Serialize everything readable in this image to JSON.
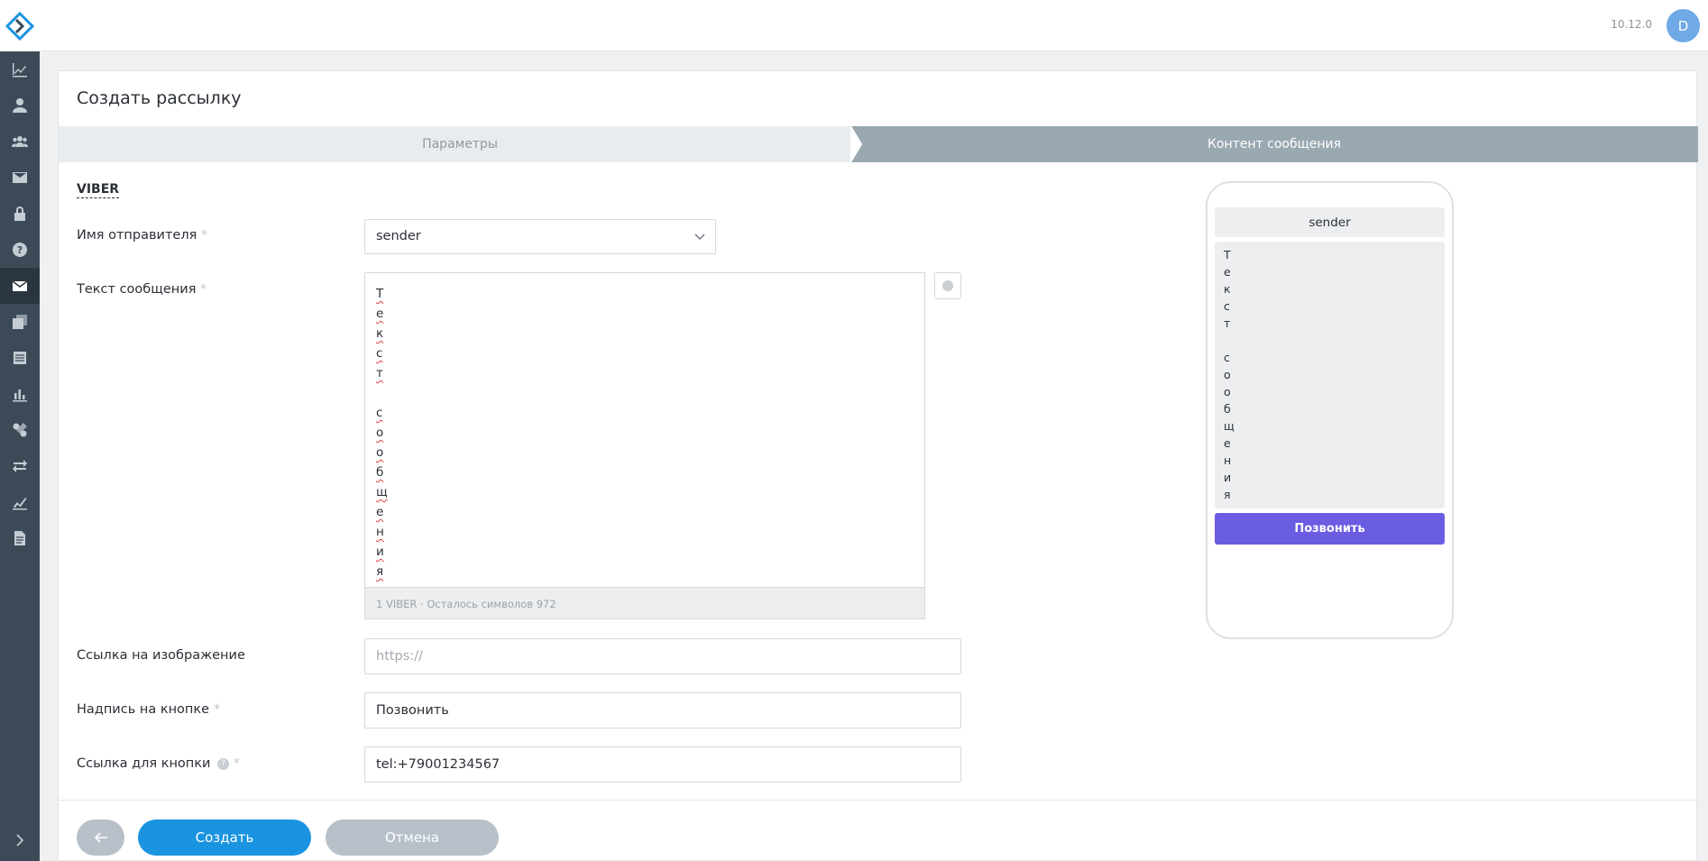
{
  "topbar": {
    "version": "10.12.0",
    "avatar_initial": "D"
  },
  "sidebar": {
    "items": [
      {
        "icon": "dashboard-chart-icon"
      },
      {
        "icon": "user-icon"
      },
      {
        "icon": "users-group-icon"
      },
      {
        "icon": "mail-icon"
      },
      {
        "icon": "lock-icon"
      },
      {
        "icon": "help-icon"
      },
      {
        "icon": "mailing-icon",
        "active": true
      },
      {
        "icon": "templates-icon"
      },
      {
        "icon": "database-icon"
      },
      {
        "icon": "bar-chart-icon"
      },
      {
        "icon": "integrations-icon"
      },
      {
        "icon": "transfer-arrows-icon"
      },
      {
        "icon": "reports-icon"
      },
      {
        "icon": "document-icon"
      }
    ]
  },
  "page": {
    "title": "Создать рассылку"
  },
  "steps": {
    "step1": "Параметры",
    "step2": "Контент сообщения"
  },
  "form": {
    "channel_label": "VIBER",
    "sender_label": "Имя отправителя",
    "sender_value": "sender",
    "message_label": "Текст сообщения",
    "message_value": "Т\nе\nк\nс\nт\n\nс\nо\nо\nб\nщ\nе\nн\nи\nя",
    "message_footer": "1 VIBER · Осталось символов 972",
    "image_link_label": "Ссылка на изображение",
    "image_link_placeholder": "https://",
    "button_text_label": "Надпись на кнопке",
    "button_text_value": "Позвонить",
    "button_link_label": "Ссылка для кнопки",
    "button_link_value": "tel:+79001234567",
    "required_mark": "*"
  },
  "preview": {
    "sender": "sender",
    "message": "Т\nе\nк\nс\nт\n\nс\nо\nо\nб\nщ\nе\nн\nи\nя",
    "button": "Позвонить"
  },
  "footer": {
    "create": "Создать",
    "cancel": "Отмена"
  },
  "colors": {
    "sidebar": "#3c4a57",
    "accent": "#1a94e0",
    "viber_button": "#6b5de2",
    "avatar": "#6fa9e6"
  }
}
